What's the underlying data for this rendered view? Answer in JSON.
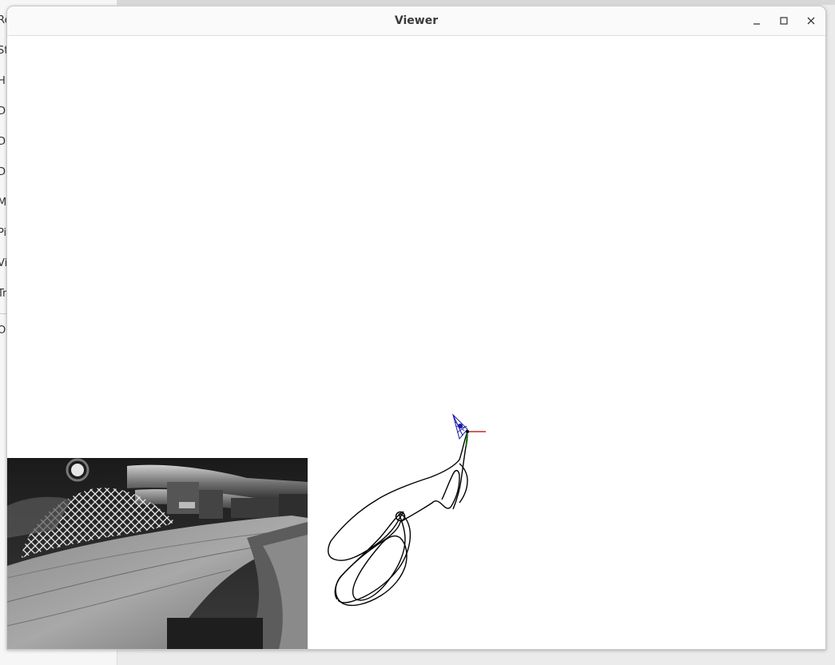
{
  "window": {
    "title": "Viewer",
    "controls": [
      "minimize-icon",
      "maximize-icon",
      "close-icon"
    ]
  },
  "background_app": {
    "sidebar_letters": [
      "Re",
      "St",
      "H",
      "D",
      "D",
      "D",
      "M",
      "Pi",
      "Vi",
      "Tr",
      "O"
    ]
  },
  "viewer": {
    "camera_thumbnail": "grayscale camera frame: wooden plank, netting, industrial pipes",
    "trajectory_color": "#000000",
    "camera_frustum_color": "#1a1aa8",
    "axis_x_color": "#b00000",
    "axis_y_color": "#00a000"
  }
}
